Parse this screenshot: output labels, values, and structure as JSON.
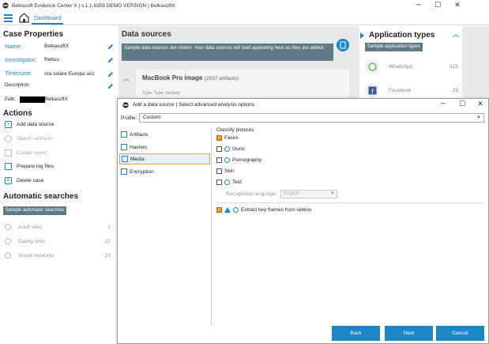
{
  "window": {
    "title": "Belkasoft Evidence Center X | v.1.1.6359 DEMO VERSION | BelkasoftX",
    "controls": {
      "minimize": "─",
      "maximize": "☐",
      "close": "✕"
    }
  },
  "nav": {
    "tab_dashboard": "Dashboard"
  },
  "case": {
    "heading": "Case Properties",
    "name_label": "Name:",
    "name_value": "BelkasoftX",
    "investigator_label": "Investigator:",
    "investigator_value": "Rebus",
    "timezone_label": "Timezone:",
    "timezone_value": "ora solare Europa occ",
    "description_label": "Description:",
    "path_label": "Path:",
    "path_value": "BelkasoftX"
  },
  "actions": {
    "heading": "Actions",
    "items": [
      {
        "label": "Add data source",
        "enabled": true
      },
      {
        "label": "Search artifacts",
        "enabled": false
      },
      {
        "label": "Create report",
        "enabled": false
      },
      {
        "label": "Prepare log files",
        "enabled": true
      },
      {
        "label": "Delete case",
        "enabled": true
      }
    ]
  },
  "auto_searches": {
    "heading": "Automatic searches",
    "sample_tag": "Sample automatic searches",
    "items": [
      {
        "label": "Adult sites",
        "count": "2"
      },
      {
        "label": "Dating sites",
        "count": "22"
      },
      {
        "label": "Social networks",
        "count": "20"
      }
    ]
  },
  "data_sources": {
    "heading": "Data sources",
    "banner": "Sample data sources are shown. Your data sources will start appearing here as they are added.",
    "card_title": "MacBook Pro image",
    "card_count": "(2937 artifacts)",
    "card_sub": "Type: Туре: backup"
  },
  "app_types": {
    "heading": "Application types",
    "sample_tag": "Sample application types",
    "items": [
      {
        "label": "WhatsApp",
        "count": "315"
      },
      {
        "label": "Facebook",
        "count": "25"
      }
    ]
  },
  "dialog": {
    "title": "Add a data source | Select advanced analysis options",
    "controls": {
      "minimize": "─",
      "maximize": "☐",
      "close": "✕"
    },
    "profile_label": "Profile:",
    "profile_value": "Custom",
    "nav": [
      {
        "label": "Artifacts",
        "selected": false
      },
      {
        "label": "Hashes",
        "selected": false
      },
      {
        "label": "Media",
        "selected": true
      },
      {
        "label": "Encryption",
        "selected": false
      }
    ],
    "classify_title": "Classify pictures",
    "options": [
      {
        "label": "Faces",
        "checked": true,
        "clock": false
      },
      {
        "label": "Guns",
        "checked": false,
        "clock": true
      },
      {
        "label": "Pornography",
        "checked": false,
        "clock": true
      },
      {
        "label": "Skin",
        "checked": false,
        "clock": false
      },
      {
        "label": "Text",
        "checked": false,
        "clock": true
      }
    ],
    "recognition_label": "Recognition language:",
    "recognition_value": "English",
    "keyframes_label": "Extract key frames from videos",
    "keyframes_checked": true,
    "buttons": {
      "back": "Back",
      "next": "Next",
      "cancel": "Cancel"
    }
  },
  "colors": {
    "accent": "#1e88c7",
    "tag_bg": "#5f7a86",
    "check": "#e28e1a",
    "panel_bg": "#e7e9ea"
  }
}
